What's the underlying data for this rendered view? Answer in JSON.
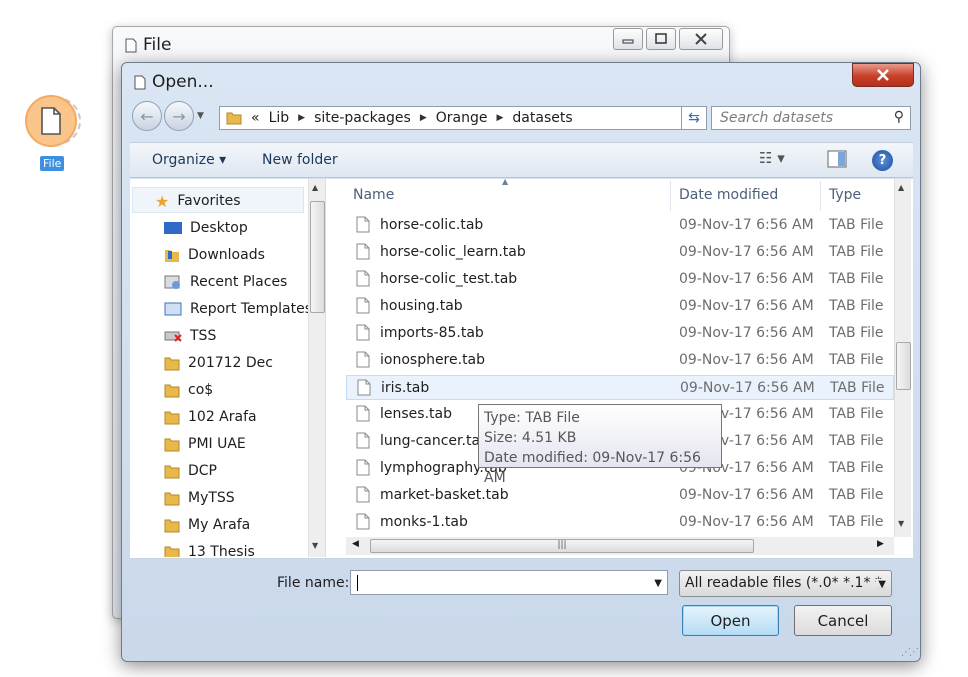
{
  "canvas_widget": {
    "label": "File"
  },
  "bg_window": {
    "title": "File"
  },
  "dialog": {
    "title": "Open...",
    "address": {
      "overflow": "«",
      "crumbs": [
        "Lib",
        "site-packages",
        "Orange",
        "datasets"
      ]
    },
    "search": {
      "placeholder": "Search datasets"
    },
    "toolbar": {
      "organize": "Organize ▾",
      "new_folder": "New folder"
    },
    "nav": {
      "items": [
        {
          "label": "Favorites",
          "icon": "star-icon"
        },
        {
          "label": "Desktop",
          "icon": "desktop-icon"
        },
        {
          "label": "Downloads",
          "icon": "downloads-folder-icon"
        },
        {
          "label": "Recent Places",
          "icon": "recent-places-icon"
        },
        {
          "label": "Report Templates",
          "icon": "report-templates-icon"
        },
        {
          "label": "TSS",
          "icon": "network-drive-icon"
        },
        {
          "label": "201712 Dec",
          "icon": "folder-icon"
        },
        {
          "label": "co$",
          "icon": "folder-icon"
        },
        {
          "label": "102 Arafa",
          "icon": "folder-icon"
        },
        {
          "label": "PMI UAE",
          "icon": "folder-icon"
        },
        {
          "label": "DCP",
          "icon": "folder-icon"
        },
        {
          "label": "MyTSS",
          "icon": "folder-icon"
        },
        {
          "label": "My Arafa",
          "icon": "folder-icon"
        },
        {
          "label": "13 Thesis",
          "icon": "folder-icon"
        }
      ]
    },
    "columns": {
      "name": "Name",
      "date": "Date modified",
      "type": "Type"
    },
    "files": [
      {
        "name": "horse-colic.tab",
        "date": "09-Nov-17 6:56 AM",
        "type": "TAB File"
      },
      {
        "name": "horse-colic_learn.tab",
        "date": "09-Nov-17 6:56 AM",
        "type": "TAB File"
      },
      {
        "name": "horse-colic_test.tab",
        "date": "09-Nov-17 6:56 AM",
        "type": "TAB File"
      },
      {
        "name": "housing.tab",
        "date": "09-Nov-17 6:56 AM",
        "type": "TAB File"
      },
      {
        "name": "imports-85.tab",
        "date": "09-Nov-17 6:56 AM",
        "type": "TAB File"
      },
      {
        "name": "ionosphere.tab",
        "date": "09-Nov-17 6:56 AM",
        "type": "TAB File"
      },
      {
        "name": "iris.tab",
        "date": "09-Nov-17 6:56 AM",
        "type": "TAB File"
      },
      {
        "name": "lenses.tab",
        "date": "09-Nov-17 6:56 AM",
        "type": "TAB File"
      },
      {
        "name": "lung-cancer.tab",
        "date": "09-Nov-17 6:56 AM",
        "type": "TAB File"
      },
      {
        "name": "lymphography.tab",
        "date": "09-Nov-17 6:56 AM",
        "type": "TAB File"
      },
      {
        "name": "market-basket.tab",
        "date": "09-Nov-17 6:56 AM",
        "type": "TAB File"
      },
      {
        "name": "monks-1.tab",
        "date": "09-Nov-17 6:56 AM",
        "type": "TAB File"
      }
    ],
    "tooltip": {
      "type": "Type: TAB File",
      "size": "Size: 4.51 KB",
      "date": "Date modified: 09-Nov-17 6:56 AM"
    },
    "file_name_label": "File name:",
    "file_name_value": "",
    "filter": "All readable files (*.0* *.1* *.",
    "open_button": "Open",
    "cancel_button": "Cancel"
  }
}
